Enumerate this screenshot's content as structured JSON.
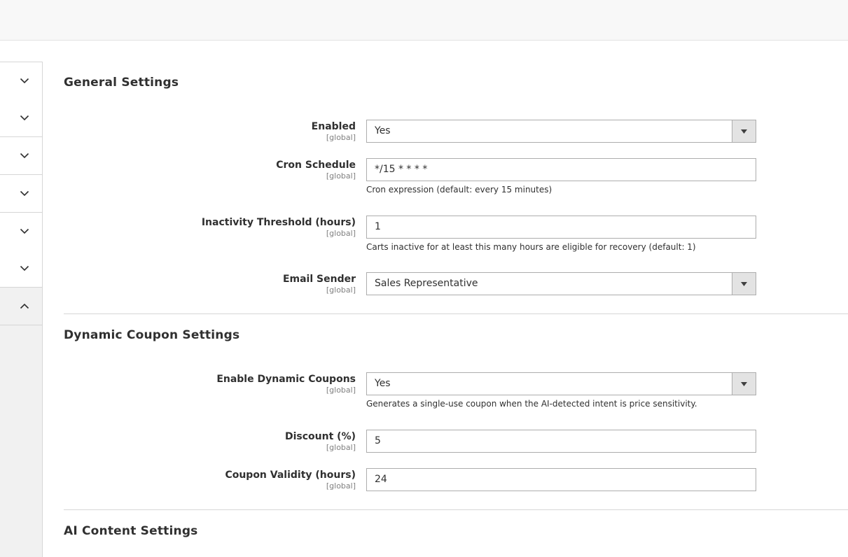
{
  "sidebar": {
    "items": [
      {
        "icon": "chevron-down-icon"
      },
      {
        "icon": "chevron-down-icon"
      },
      {
        "icon": "chevron-down-icon"
      },
      {
        "icon": "chevron-down-icon"
      },
      {
        "icon": "chevron-down-icon"
      },
      {
        "icon": "chevron-down-icon"
      },
      {
        "icon": "chevron-up-icon"
      }
    ]
  },
  "general": {
    "title": "General Settings",
    "enabled": {
      "label": "Enabled",
      "scope": "[global]",
      "value": "Yes"
    },
    "cron": {
      "label": "Cron Schedule",
      "scope": "[global]",
      "value": "*/15 * * * *",
      "note": "Cron expression (default: every 15 minutes)"
    },
    "inactivity": {
      "label": "Inactivity Threshold (hours)",
      "scope": "[global]",
      "value": "1",
      "note": "Carts inactive for at least this many hours are eligible for recovery (default: 1)"
    },
    "sender": {
      "label": "Email Sender",
      "scope": "[global]",
      "value": "Sales Representative"
    }
  },
  "coupon": {
    "title": "Dynamic Coupon Settings",
    "enable": {
      "label": "Enable Dynamic Coupons",
      "scope": "[global]",
      "value": "Yes",
      "note": "Generates a single-use coupon when the AI-detected intent is price sensitivity."
    },
    "discount": {
      "label": "Discount (%)",
      "scope": "[global]",
      "value": "5"
    },
    "validity": {
      "label": "Coupon Validity (hours)",
      "scope": "[global]",
      "value": "24"
    }
  },
  "ai": {
    "title": "AI Content Settings"
  },
  "colors": {
    "background": "#ffffff",
    "topbar": "#f8f8f8",
    "sidebar": "#f1f1f1",
    "border": "#adadad",
    "text": "#303030"
  }
}
